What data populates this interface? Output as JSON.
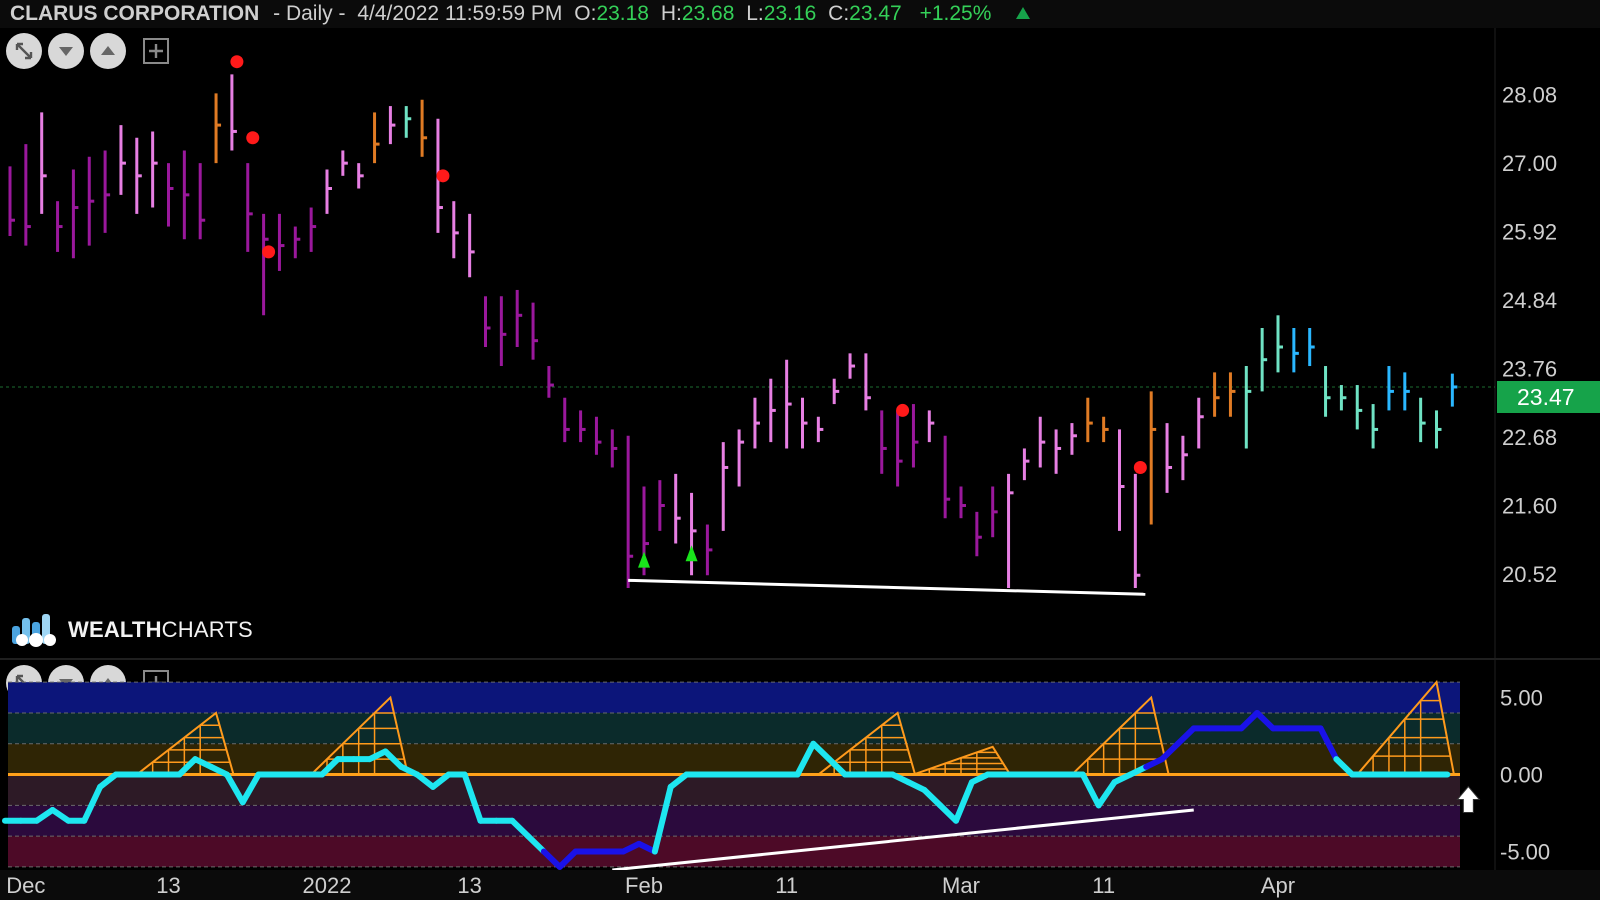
{
  "header": {
    "symbol": "CLARUS CORPORATION",
    "interval": "- Daily -",
    "datetime": "4/4/2022 11:59:59 PM",
    "o_label": "O:",
    "o_value": "23.18",
    "h_label": "H:",
    "h_value": "23.68",
    "l_label": "L:",
    "l_value": "23.16",
    "c_label": "C:",
    "c_value": "23.47",
    "change": "+1.25%",
    "up_arrow_icon": "triangle-up-icon",
    "change_color": "#34d058"
  },
  "toolbar_icons": [
    "expand-icon",
    "chevron-down-icon",
    "chevron-up-icon",
    "plus-icon"
  ],
  "logo": {
    "text_bold": "WEALTH",
    "text_light": "CHARTS"
  },
  "last_price": "23.47",
  "colors": {
    "strong_bull": "#2ab7ff",
    "bull": "#6fe3c4",
    "neutral_orange": "#e07b24",
    "weak_pink": "#e77fe3",
    "bear": "#9a189c",
    "signal_red": "#ff1a1a",
    "signal_green": "#19e31b",
    "price_tag": "#16a34a"
  },
  "chart_data": [
    {
      "type": "candlestick-bars",
      "title": "",
      "y_ticks": [
        "28.08",
        "27.00",
        "25.92",
        "24.84",
        "23.76",
        "22.68",
        "21.60",
        "20.52"
      ],
      "y_tick_values": [
        28.08,
        27.0,
        25.92,
        24.84,
        23.76,
        22.68,
        21.6,
        20.52
      ],
      "ylim": [
        19.4,
        29.1
      ],
      "x_ticks": [
        "Dec",
        "13",
        "2022",
        "13",
        "Feb",
        "11",
        "Mar",
        "11",
        "Apr"
      ],
      "x_tick_index": [
        1,
        10,
        20,
        29,
        40,
        49,
        60,
        69,
        80
      ],
      "last_price_line": 23.47,
      "bars": [
        {
          "h": 26.95,
          "l": 25.85,
          "c": 26.1,
          "t": "bear"
        },
        {
          "h": 27.3,
          "l": 25.7,
          "c": 26.0,
          "t": "bear"
        },
        {
          "h": 27.8,
          "l": 26.2,
          "c": 26.8,
          "t": "weak"
        },
        {
          "h": 26.4,
          "l": 25.6,
          "c": 26.0,
          "t": "bear"
        },
        {
          "h": 26.9,
          "l": 25.5,
          "c": 26.3,
          "t": "bear"
        },
        {
          "h": 27.1,
          "l": 25.7,
          "c": 26.4,
          "t": "bear"
        },
        {
          "h": 27.2,
          "l": 25.9,
          "c": 26.5,
          "t": "bear"
        },
        {
          "h": 27.6,
          "l": 26.5,
          "c": 27.0,
          "t": "weak"
        },
        {
          "h": 27.4,
          "l": 26.2,
          "c": 26.8,
          "t": "weak"
        },
        {
          "h": 27.5,
          "l": 26.3,
          "c": 27.0,
          "t": "weak"
        },
        {
          "h": 27.0,
          "l": 26.0,
          "c": 26.6,
          "t": "bear"
        },
        {
          "h": 27.2,
          "l": 25.8,
          "c": 26.5,
          "t": "bear"
        },
        {
          "h": 27.0,
          "l": 25.8,
          "c": 26.1,
          "t": "bear"
        },
        {
          "h": 28.1,
          "l": 27.0,
          "c": 27.6,
          "t": "orange"
        },
        {
          "h": 28.4,
          "l": 27.2,
          "c": 27.5,
          "t": "weak"
        },
        {
          "h": 27.0,
          "l": 25.6,
          "c": 26.2,
          "t": "bear"
        },
        {
          "h": 26.2,
          "l": 24.6,
          "c": 25.8,
          "t": "bear"
        },
        {
          "h": 26.2,
          "l": 25.3,
          "c": 25.7,
          "t": "bear"
        },
        {
          "h": 26.0,
          "l": 25.5,
          "c": 25.8,
          "t": "bear"
        },
        {
          "h": 26.3,
          "l": 25.6,
          "c": 26.0,
          "t": "bear"
        },
        {
          "h": 26.9,
          "l": 26.2,
          "c": 26.6,
          "t": "weak"
        },
        {
          "h": 27.2,
          "l": 26.8,
          "c": 27.0,
          "t": "weak"
        },
        {
          "h": 27.0,
          "l": 26.6,
          "c": 26.8,
          "t": "weak"
        },
        {
          "h": 27.8,
          "l": 27.0,
          "c": 27.3,
          "t": "orange"
        },
        {
          "h": 27.9,
          "l": 27.3,
          "c": 27.6,
          "t": "weak"
        },
        {
          "h": 27.9,
          "l": 27.4,
          "c": 27.7,
          "t": "bull"
        },
        {
          "h": 28.0,
          "l": 27.1,
          "c": 27.4,
          "t": "orange"
        },
        {
          "h": 27.7,
          "l": 25.9,
          "c": 26.3,
          "t": "weak"
        },
        {
          "h": 26.4,
          "l": 25.5,
          "c": 25.9,
          "t": "weak"
        },
        {
          "h": 26.2,
          "l": 25.2,
          "c": 25.6,
          "t": "weak"
        },
        {
          "h": 24.9,
          "l": 24.1,
          "c": 24.4,
          "t": "bear"
        },
        {
          "h": 24.9,
          "l": 23.8,
          "c": 24.3,
          "t": "bear"
        },
        {
          "h": 25.0,
          "l": 24.1,
          "c": 24.6,
          "t": "bear"
        },
        {
          "h": 24.8,
          "l": 23.9,
          "c": 24.2,
          "t": "bear"
        },
        {
          "h": 23.8,
          "l": 23.3,
          "c": 23.5,
          "t": "bear"
        },
        {
          "h": 23.3,
          "l": 22.6,
          "c": 22.8,
          "t": "bear"
        },
        {
          "h": 23.1,
          "l": 22.6,
          "c": 22.8,
          "t": "bear"
        },
        {
          "h": 23.0,
          "l": 22.4,
          "c": 22.6,
          "t": "bear"
        },
        {
          "h": 22.8,
          "l": 22.2,
          "c": 22.5,
          "t": "bear"
        },
        {
          "h": 22.7,
          "l": 20.3,
          "c": 20.8,
          "t": "bear"
        },
        {
          "h": 21.9,
          "l": 20.5,
          "c": 21.0,
          "t": "bear"
        },
        {
          "h": 22.0,
          "l": 21.2,
          "c": 21.6,
          "t": "bear"
        },
        {
          "h": 22.1,
          "l": 21.0,
          "c": 21.4,
          "t": "weak"
        },
        {
          "h": 21.8,
          "l": 20.5,
          "c": 21.2,
          "t": "weak"
        },
        {
          "h": 21.3,
          "l": 20.5,
          "c": 20.9,
          "t": "bear"
        },
        {
          "h": 22.6,
          "l": 21.2,
          "c": 22.2,
          "t": "weak"
        },
        {
          "h": 22.8,
          "l": 21.9,
          "c": 22.6,
          "t": "weak"
        },
        {
          "h": 23.3,
          "l": 22.5,
          "c": 22.9,
          "t": "weak"
        },
        {
          "h": 23.6,
          "l": 22.6,
          "c": 23.1,
          "t": "weak"
        },
        {
          "h": 23.9,
          "l": 22.5,
          "c": 23.2,
          "t": "weak"
        },
        {
          "h": 23.3,
          "l": 22.5,
          "c": 22.9,
          "t": "weak"
        },
        {
          "h": 23.0,
          "l": 22.6,
          "c": 22.8,
          "t": "weak"
        },
        {
          "h": 23.6,
          "l": 23.2,
          "c": 23.4,
          "t": "weak"
        },
        {
          "h": 24.0,
          "l": 23.6,
          "c": 23.8,
          "t": "weak"
        },
        {
          "h": 24.0,
          "l": 23.1,
          "c": 23.3,
          "t": "weak"
        },
        {
          "h": 23.1,
          "l": 22.1,
          "c": 22.5,
          "t": "bear"
        },
        {
          "h": 23.1,
          "l": 21.9,
          "c": 22.3,
          "t": "bear"
        },
        {
          "h": 23.2,
          "l": 22.2,
          "c": 22.6,
          "t": "bear"
        },
        {
          "h": 23.1,
          "l": 22.6,
          "c": 22.9,
          "t": "weak"
        },
        {
          "h": 22.7,
          "l": 21.4,
          "c": 21.7,
          "t": "bear"
        },
        {
          "h": 21.9,
          "l": 21.4,
          "c": 21.6,
          "t": "bear"
        },
        {
          "h": 21.5,
          "l": 20.8,
          "c": 21.1,
          "t": "bear"
        },
        {
          "h": 21.9,
          "l": 21.1,
          "c": 21.5,
          "t": "bear"
        },
        {
          "h": 22.1,
          "l": 20.3,
          "c": 21.8,
          "t": "weak"
        },
        {
          "h": 22.5,
          "l": 22.0,
          "c": 22.3,
          "t": "weak"
        },
        {
          "h": 23.0,
          "l": 22.2,
          "c": 22.6,
          "t": "weak"
        },
        {
          "h": 22.8,
          "l": 22.1,
          "c": 22.5,
          "t": "weak"
        },
        {
          "h": 22.9,
          "l": 22.4,
          "c": 22.7,
          "t": "weak"
        },
        {
          "h": 23.3,
          "l": 22.6,
          "c": 22.9,
          "t": "orange"
        },
        {
          "h": 23.0,
          "l": 22.6,
          "c": 22.8,
          "t": "orange"
        },
        {
          "h": 22.8,
          "l": 21.2,
          "c": 21.9,
          "t": "weak"
        },
        {
          "h": 22.1,
          "l": 20.3,
          "c": 20.5,
          "t": "weak"
        },
        {
          "h": 23.4,
          "l": 21.3,
          "c": 22.8,
          "t": "orange"
        },
        {
          "h": 22.9,
          "l": 21.8,
          "c": 22.2,
          "t": "weak"
        },
        {
          "h": 22.7,
          "l": 22.0,
          "c": 22.4,
          "t": "weak"
        },
        {
          "h": 23.3,
          "l": 22.5,
          "c": 23.0,
          "t": "weak"
        },
        {
          "h": 23.7,
          "l": 23.0,
          "c": 23.3,
          "t": "orange"
        },
        {
          "h": 23.7,
          "l": 23.0,
          "c": 23.4,
          "t": "orange"
        },
        {
          "h": 23.8,
          "l": 22.5,
          "c": 23.4,
          "t": "bull"
        },
        {
          "h": 24.4,
          "l": 23.4,
          "c": 23.9,
          "t": "bull"
        },
        {
          "h": 24.6,
          "l": 23.7,
          "c": 24.1,
          "t": "bull"
        },
        {
          "h": 24.4,
          "l": 23.7,
          "c": 24.0,
          "t": "strong"
        },
        {
          "h": 24.4,
          "l": 23.8,
          "c": 24.1,
          "t": "strong"
        },
        {
          "h": 23.8,
          "l": 23.0,
          "c": 23.3,
          "t": "bull"
        },
        {
          "h": 23.5,
          "l": 23.1,
          "c": 23.3,
          "t": "bull"
        },
        {
          "h": 23.5,
          "l": 22.8,
          "c": 23.1,
          "t": "bull"
        },
        {
          "h": 23.2,
          "l": 22.5,
          "c": 22.8,
          "t": "bull"
        },
        {
          "h": 23.8,
          "l": 23.1,
          "c": 23.4,
          "t": "strong"
        },
        {
          "h": 23.7,
          "l": 23.1,
          "c": 23.4,
          "t": "strong"
        },
        {
          "h": 23.3,
          "l": 22.6,
          "c": 22.9,
          "t": "bull"
        },
        {
          "h": 23.1,
          "l": 22.5,
          "c": 22.8,
          "t": "bull"
        },
        {
          "h": 23.68,
          "l": 23.16,
          "c": 23.47,
          "t": "strong"
        }
      ],
      "signals": [
        {
          "i": 14,
          "type": "red-dot",
          "price": 28.6
        },
        {
          "i": 15,
          "type": "red-dot",
          "price": 27.4
        },
        {
          "i": 27,
          "type": "red-dot",
          "price": 26.8
        },
        {
          "i": 16,
          "type": "red-dot",
          "price": 25.6
        },
        {
          "i": 40,
          "type": "green-triangle",
          "price": 20.7
        },
        {
          "i": 43,
          "type": "green-triangle",
          "price": 20.8
        },
        {
          "i": 56,
          "type": "red-dot",
          "price": 23.1
        },
        {
          "i": 71,
          "type": "red-dot",
          "price": 22.2
        }
      ],
      "trendline": [
        {
          "i": 39,
          "price": 20.42
        },
        {
          "i": 71,
          "price": 20.2
        }
      ]
    },
    {
      "type": "oscillator",
      "title": "",
      "y_ticks": [
        "5.00",
        "0.00",
        "-5.00"
      ],
      "y_tick_values": [
        5,
        0,
        -5
      ],
      "ylim": [
        -6.2,
        6.4
      ],
      "bands": [
        {
          "from": 4.0,
          "to": 6.0,
          "color": "#0c157a"
        },
        {
          "from": 2.0,
          "to": 4.0,
          "color": "#0b2b2b"
        },
        {
          "from": 0.0,
          "to": 2.0,
          "color": "#2f2505"
        },
        {
          "from": -2.0,
          "to": 0.0,
          "color": "#2d1a26"
        },
        {
          "from": -4.0,
          "to": -2.0,
          "color": "#2b0a3d"
        },
        {
          "from": -6.0,
          "to": -4.0,
          "color": "#4d0a27"
        }
      ],
      "line_values": [
        -3,
        -3,
        -3,
        -2.3,
        -3,
        -3,
        -0.8,
        0,
        0,
        0,
        0,
        0,
        1,
        0.5,
        0,
        -1.8,
        0,
        0,
        0,
        0,
        0,
        1,
        1,
        1,
        1.5,
        0.5,
        0,
        -0.8,
        0,
        0,
        -3,
        -3,
        -3,
        -4,
        -5,
        -6,
        -5,
        -5,
        -5,
        -5,
        -4.5,
        -5,
        -0.8,
        0,
        0,
        0,
        0,
        0,
        0,
        0,
        0,
        2,
        1,
        0,
        0,
        0,
        0,
        -0.5,
        -1,
        -2,
        -3,
        -0.5,
        0,
        0,
        0,
        0,
        0,
        0,
        0,
        -2,
        -0.5,
        0,
        0.5,
        1,
        2,
        3,
        3,
        3,
        3,
        4,
        3,
        3,
        3,
        3,
        1,
        0,
        0,
        0,
        0,
        0,
        0,
        0
      ],
      "line_colors_by_sign": {
        "positive_or_zero": "#1ee6f0",
        "strong_negative": "#1a12e8"
      },
      "hist_peaks": [
        {
          "i": 13,
          "v": 4.0
        },
        {
          "i": 24,
          "v": 5.0
        },
        {
          "i": 56,
          "v": 4.0
        },
        {
          "i": 62,
          "v": 1.8
        },
        {
          "i": 72,
          "v": 5.0
        },
        {
          "i": 90,
          "v": 6.0
        }
      ],
      "trendline": [
        {
          "i": 38,
          "v": -6.2
        },
        {
          "i": 75,
          "v": -2.3
        }
      ],
      "zero_line": 0
    }
  ]
}
